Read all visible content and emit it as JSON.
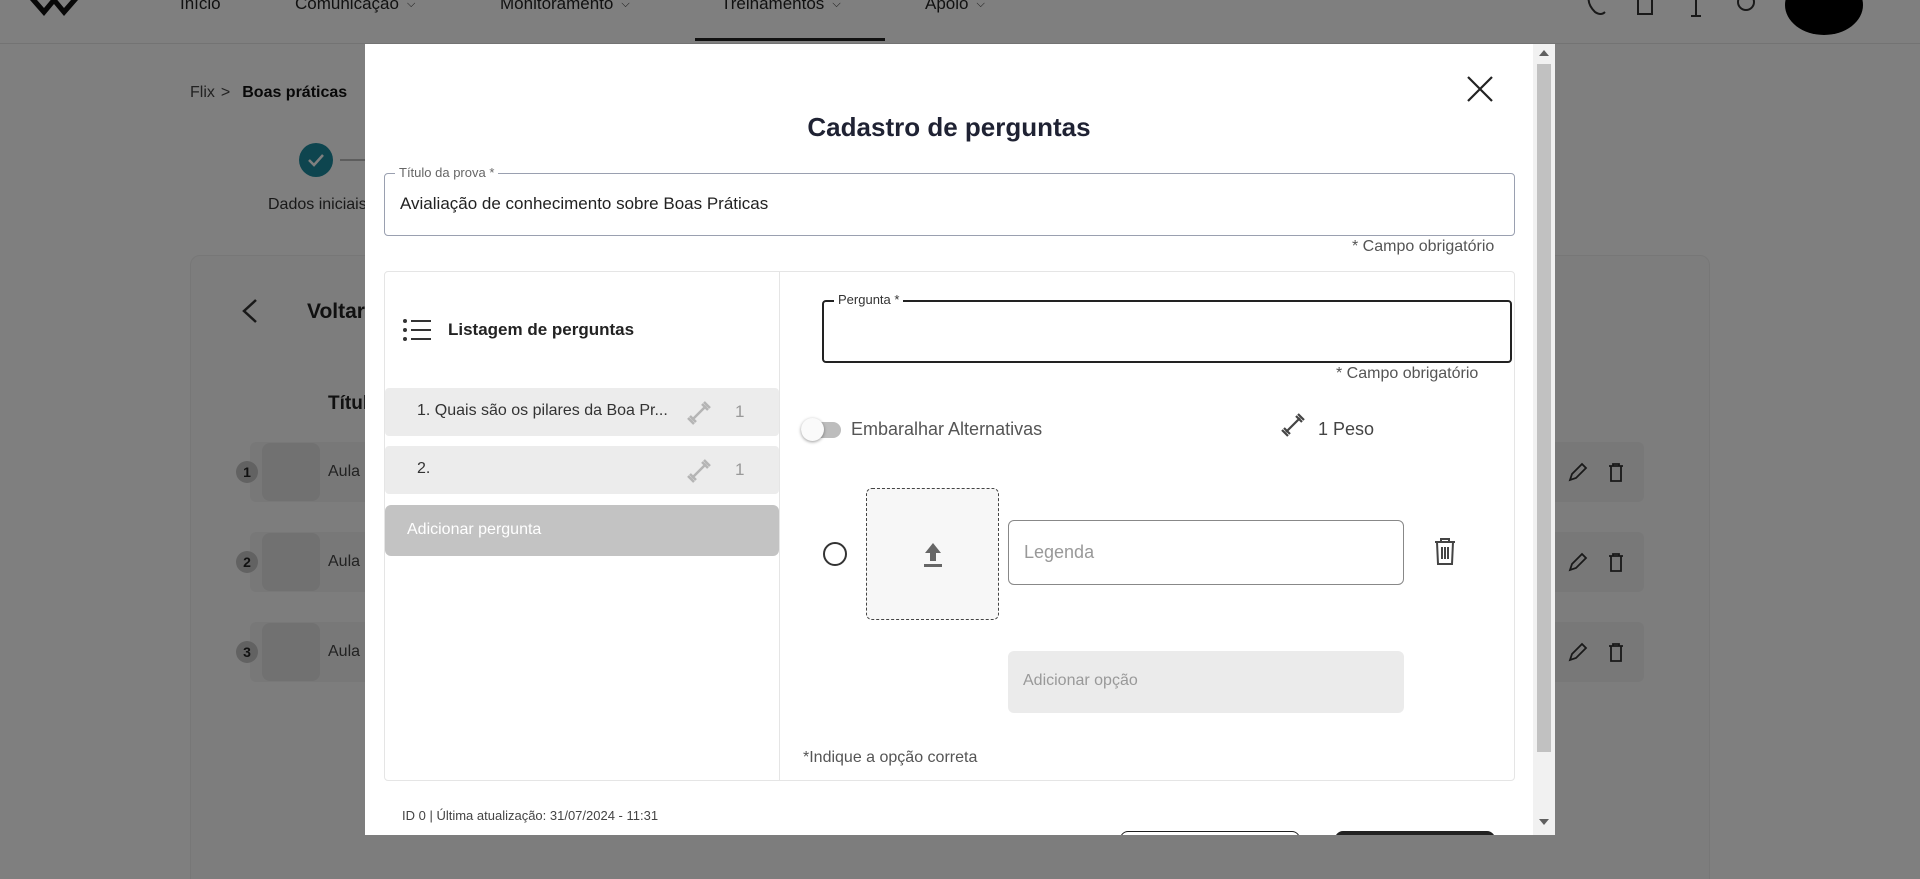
{
  "background": {
    "nav": {
      "items": [
        {
          "label": "Início"
        },
        {
          "label": "Comunicação"
        },
        {
          "label": "Monitoramento"
        },
        {
          "label": "Treinamentos"
        },
        {
          "label": "Apoio"
        }
      ]
    },
    "breadcrumb": {
      "root": "Flix",
      "separator": ">",
      "current": "Boas práticas"
    },
    "stepper": {
      "step1_label": "Dados iniciais"
    },
    "back_label": "Voltar",
    "column_title": "Títul",
    "rows": [
      {
        "num": "1",
        "label": "Aula",
        "icon": "film-icon"
      },
      {
        "num": "2",
        "label": "Aula",
        "icon": "image-icon"
      },
      {
        "num": "3",
        "label": "Aula",
        "icon": "images-icon"
      }
    ]
  },
  "modal": {
    "title": "Cadastro de perguntas",
    "exam_title": {
      "label": "Título da prova *",
      "value": "Avialiação de conhecimento sobre Boas Práticas",
      "required_note": "* Campo obrigatório"
    },
    "question_list": {
      "title": "Listagem de perguntas",
      "items": [
        {
          "text": "1. Quais são os pilares da Boa Pr...",
          "weight": "1"
        },
        {
          "text": "2.",
          "weight": "1"
        }
      ],
      "add_label": "Adicionar pergunta"
    },
    "editor": {
      "question_label": "Pergunta *",
      "question_value": "",
      "required_note": "* Campo obrigatório",
      "shuffle_label": "Embaralhar Alternativas",
      "shuffle_on": false,
      "weight_label": "1 Peso",
      "option": {
        "caption_placeholder": "Legenda"
      },
      "add_option_label": "Adicionar opção",
      "correct_note": "*Indique a opção correta"
    },
    "footer": {
      "info": "ID 0 | Última atualização: 31/07/2024 - 11:31"
    }
  },
  "colors": {
    "accent": "#1c8a9e",
    "overlay": "rgba(0,0,0,0.5)"
  }
}
